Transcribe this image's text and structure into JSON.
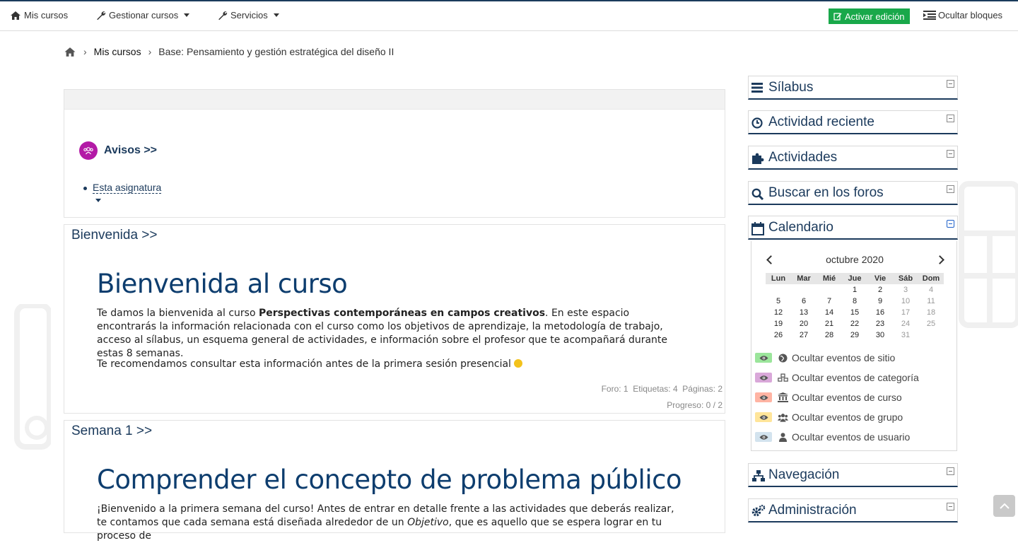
{
  "topbar": {
    "my_courses": "Mis cursos",
    "manage_courses": "Gestionar cursos",
    "services": "Servicios",
    "edit_button": "Activar edición",
    "hide_blocks": "Ocultar bloques"
  },
  "breadcrumb": {
    "items": [
      "Mis cursos",
      "Base: Pensamiento y gestión estratégica del diseño II"
    ]
  },
  "news": {
    "title": "Avisos >>",
    "link": "Esta asignatura"
  },
  "welcome": {
    "section_title": "Bienvenida >>",
    "heading": "Bienvenida al curso",
    "p1_pre": "Te damos la bienvenida al curso ",
    "p1_bold": "Perspectivas contemporáneas en campos creativos",
    "p1_post": ". En este espacio encontrarás la información relacionada con el curso como los objetivos de aprendizaje, la metodología de trabajo, acceso al sílabus, un esquema general de actividades, e información sobre el profesor que te acompañará durante estas 8 semanas.",
    "p2": "Te recomendamos consultar esta información antes de la primera sesión presencial",
    "stats": "Foro: 1  Etiquetas: 4  Páginas: 2",
    "progress": "Progreso: 0 / 2"
  },
  "week1": {
    "section_title": "Semana 1 >>",
    "heading": "Comprender el concepto de problema público",
    "p1_pre": "¡Bienvenido a la primera semana del curso! Antes de entrar en detalle frente a las actividades que deberás realizar, te contamos que cada semana está diseñada alrededor de un ",
    "p1_italic": "Objetivo",
    "p1_post": ", que es aquello que se espera lograr en tu proceso de"
  },
  "blocks": {
    "silabus": "Sílabus",
    "recent": "Actividad reciente",
    "activities": "Actividades",
    "search_forums": "Buscar en los foros",
    "calendar": "Calendario",
    "navigation": "Navegación",
    "admin": "Administración"
  },
  "calendar": {
    "month": "octubre 2020",
    "weekdays": [
      "Lun",
      "Mar",
      "Mié",
      "Jue",
      "Vie",
      "Sáb",
      "Dom"
    ],
    "weeks": [
      [
        "",
        "",
        "",
        "1",
        "2",
        "3",
        "4"
      ],
      [
        "5",
        "6",
        "7",
        "8",
        "9",
        "10",
        "11"
      ],
      [
        "12",
        "13",
        "14",
        "15",
        "16",
        "17",
        "18"
      ],
      [
        "19",
        "20",
        "21",
        "22",
        "23",
        "24",
        "25"
      ],
      [
        "26",
        "27",
        "28",
        "29",
        "30",
        "31",
        ""
      ]
    ],
    "legend": [
      {
        "label": "Ocultar eventos de sitio",
        "color": "#9be59b",
        "icon": "globe-icon"
      },
      {
        "label": "Ocultar eventos de categoría",
        "color": "#d9a8d9",
        "icon": "cubes-icon"
      },
      {
        "label": "Ocultar eventos de curso",
        "color": "#ffb4a3",
        "icon": "institution-icon"
      },
      {
        "label": "Ocultar eventos de grupo",
        "color": "#ffe59a",
        "icon": "group-icon"
      },
      {
        "label": "Ocultar eventos de usuario",
        "color": "#d3e3ee",
        "icon": "user-icon"
      }
    ]
  },
  "colors": {
    "brand_dark": "#1b3a5c",
    "edit_green": "#19a84a",
    "avisos_purple": "#b31aa6"
  }
}
